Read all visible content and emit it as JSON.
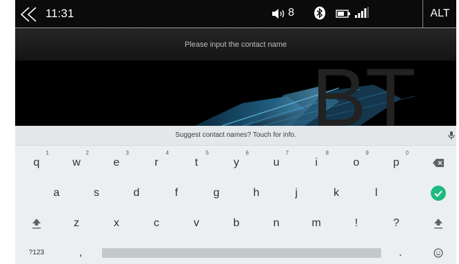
{
  "status_bar": {
    "time": "11:31",
    "volume_level": "8",
    "alt_label": "ALT",
    "icons": [
      "back-chevrons-icon",
      "volume-icon",
      "bluetooth-icon",
      "battery-icon",
      "signal-icon"
    ]
  },
  "input": {
    "placeholder": "Please input the contact name",
    "value": ""
  },
  "background": {
    "watermark": "BT"
  },
  "keyboard": {
    "suggestion": "Suggest contact names? Touch for info.",
    "row1": [
      {
        "key": "q",
        "hint": "1"
      },
      {
        "key": "w",
        "hint": "2"
      },
      {
        "key": "e",
        "hint": "3"
      },
      {
        "key": "r",
        "hint": "4"
      },
      {
        "key": "t",
        "hint": "5"
      },
      {
        "key": "y",
        "hint": "6"
      },
      {
        "key": "u",
        "hint": "7"
      },
      {
        "key": "i",
        "hint": "8"
      },
      {
        "key": "o",
        "hint": "9"
      },
      {
        "key": "p",
        "hint": "0"
      }
    ],
    "row2": [
      "a",
      "s",
      "d",
      "f",
      "g",
      "h",
      "j",
      "k",
      "l"
    ],
    "row3": [
      "z",
      "x",
      "c",
      "v",
      "b",
      "n",
      "m",
      "!",
      "?"
    ],
    "row4": {
      "symbols_label": "?123",
      "comma": ",",
      "period": "."
    },
    "icons": [
      "backspace-icon",
      "enter-check-icon",
      "shift-icon",
      "emoji-icon",
      "mic-icon"
    ],
    "accent_color": "#1eb980"
  }
}
